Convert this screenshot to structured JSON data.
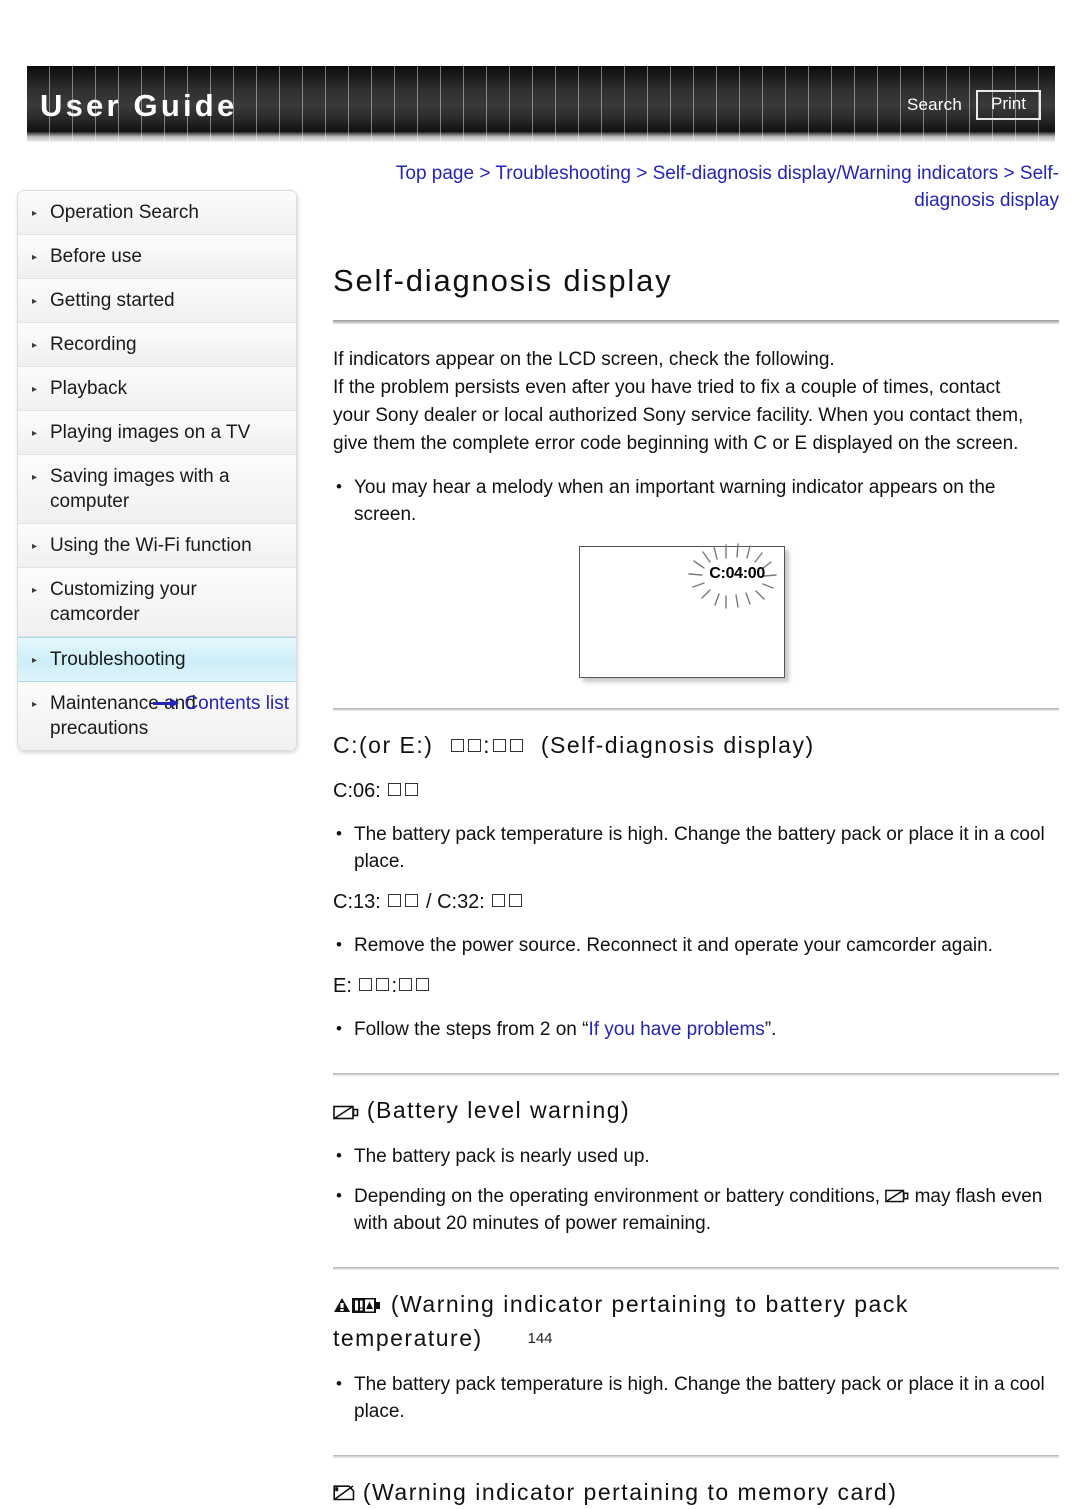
{
  "header": {
    "title": "User Guide",
    "search_label": "Search",
    "print_label": "Print"
  },
  "sidebar": {
    "items": [
      {
        "label": "Operation Search",
        "active": false
      },
      {
        "label": "Before use",
        "active": false
      },
      {
        "label": "Getting started",
        "active": false
      },
      {
        "label": "Recording",
        "active": false
      },
      {
        "label": "Playback",
        "active": false
      },
      {
        "label": "Playing images on a TV",
        "active": false
      },
      {
        "label": "Saving images with a computer",
        "active": false
      },
      {
        "label": "Using the Wi-Fi function",
        "active": false
      },
      {
        "label": "Customizing your camcorder",
        "active": false
      },
      {
        "label": "Troubleshooting",
        "active": true
      },
      {
        "label": "Maintenance and precautions",
        "active": false
      }
    ],
    "contents_link": "Contents list"
  },
  "breadcrumb": {
    "text": "Top page > Troubleshooting > Self-diagnosis display/Warning indicators > Self-diagnosis display"
  },
  "main": {
    "title": "Self-diagnosis display",
    "intro_lines": [
      "If indicators appear on the LCD screen, check the following.",
      "If the problem persists even after you have tried to fix a couple of times, contact",
      "your Sony dealer or local authorized Sony service facility. When you contact them,",
      "give them the complete error code beginning with C or E displayed on the screen."
    ],
    "intro_bullet": "You may hear a melody when an important warning indicator appears on the screen.",
    "lcd": {
      "code": "C:04:00",
      "caption_icon": "blinking-code-illustration"
    },
    "sections": [
      {
        "id": "self-diagnosis",
        "heading_prefix": "C:(or E:)",
        "heading_suffix": "(Self-diagnosis display)",
        "codes": [
          {
            "text": "C:06:",
            "boxes": 2
          }
        ],
        "bullets": [
          "The battery pack temperature is high. Change the battery pack or place it in a cool place."
        ],
        "codes2": [
          {
            "text": "C:13:",
            "boxes": 2,
            "sep": "/",
            "text2": "C:32:",
            "boxes2": 2
          }
        ],
        "bullets2": [
          "Remove the power source. Reconnect it and operate your camcorder again."
        ],
        "codes3": [
          {
            "text": "E:",
            "boxes": 4
          }
        ],
        "bullets3_prefix": "Follow the steps from 2 on “",
        "bullets3_link": "If you have problems",
        "bullets3_suffix": "”."
      },
      {
        "id": "battery-level-warning",
        "icon": "battery-empty-icon",
        "heading": "(Battery level warning)",
        "bullets": [
          "The battery pack is nearly used up."
        ],
        "bullet_with_icon_prefix": "Depending on the operating environment or battery conditions,",
        "bullet_with_icon_suffix": "may flash even with about 20 minutes of power remaining."
      },
      {
        "id": "battery-temperature-warning",
        "icon": "warning-triangle-battery-icon",
        "heading": "(Warning indicator pertaining to battery pack temperature)",
        "bullets": [
          "The battery pack temperature is high. Change the battery pack or place it in a cool place."
        ]
      },
      {
        "id": "memory-card-warning",
        "icon": "memory-card-warning-icon",
        "heading": "(Warning indicator pertaining to memory card)",
        "bullets": []
      }
    ]
  },
  "footer": {
    "page_number": "144"
  }
}
